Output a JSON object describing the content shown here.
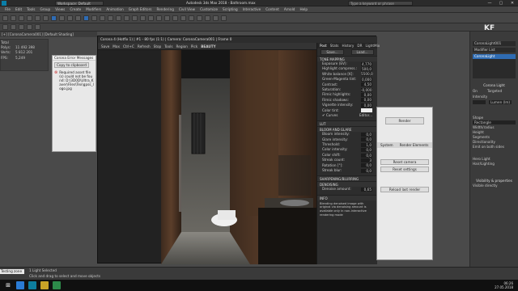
{
  "titlebar": {
    "workspace": "Workspace: Default",
    "title": "Autodesk 3ds Max 2018 - Bathroom.max",
    "search_placeholder": "Type a keyword or phrase",
    "min": "—",
    "max": "▢",
    "close": "✕"
  },
  "menu": [
    "File",
    "Edit",
    "Tools",
    "Group",
    "Views",
    "Create",
    "Modifiers",
    "Animation",
    "Graph Editors",
    "Rendering",
    "Civil View",
    "Customize",
    "Scripting",
    "Interactive",
    "Content",
    "Arnold",
    "Help"
  ],
  "viewport": {
    "label": "[+] [CoronaCamera001] [Default Shading]",
    "stats": {
      "total": "Total",
      "polys_label": "Polys:",
      "polys": "11 492 398",
      "verts_label": "Verts:",
      "verts": "5 812 201",
      "fps_label": "FPS:",
      "fps": "5,249"
    }
  },
  "error": {
    "title": "Corona Error Messages",
    "copy": "Copy to clipboard",
    "clear": "Clear",
    "msg": "Required asset file(s) could not be found: D:\\3D0D\\Ultra_Kaver\\Files\\Tex\\gpss_logo.jpg"
  },
  "vfb": {
    "title": "Corona 4 (Hotfix 1) | #1 - 80 fps (1:1) | Camera: CoronaCamera001 | Frame 0",
    "tools": [
      "Save",
      "Max",
      "Ctrl+C",
      "Refresh",
      "Stop",
      "Tools",
      "Region",
      "Pick",
      "BEAUTY"
    ],
    "tabs": [
      "Post",
      "Stats",
      "History",
      "DR",
      "LightMix"
    ],
    "save": "Save...",
    "load": "Load..."
  },
  "tone": {
    "header": "TONE MAPPING",
    "rows": [
      [
        "Exposure (EV):",
        "4,770"
      ],
      [
        "Highlight compress.:",
        "500,0"
      ],
      [
        "White balance [K]:",
        "5500,0"
      ],
      [
        "Green-Magenta tint:",
        "0,000"
      ],
      [
        "Contrast:",
        "4,50"
      ],
      [
        "Saturation:",
        "-0,000"
      ],
      [
        "Filmic highlights:",
        "0,00"
      ],
      [
        "Filmic shadows:",
        "0,00"
      ],
      [
        "Vignette intensity:",
        "0,00"
      ],
      [
        "Color tint:",
        ""
      ]
    ],
    "curves": "Curves",
    "editor": "Editor..."
  },
  "sections": {
    "lut": "LUT",
    "bloom": "BLOOM AND GLARE",
    "sharp": "SHARPENING/BLURRING",
    "denoise": "DENOISING",
    "info": "INFO"
  },
  "bloom": [
    [
      "Bloom intensity:",
      "0,0"
    ],
    [
      "Glare intensity:",
      "0,0"
    ],
    [
      "Threshold:",
      "1,0"
    ],
    [
      "Color intensity:",
      "0,0"
    ],
    [
      "Color shift:",
      "0,0"
    ],
    [
      "Streak count:",
      "3"
    ],
    [
      "Rotation [°]:",
      "0,0"
    ],
    [
      "Streak blur:",
      "0,0"
    ]
  ],
  "denoise_amount": [
    "Denoise amount:",
    "0,65"
  ],
  "info_text": "Blending denoised image with original via denoising amount is available only in non-interactive rendering mode",
  "renderset": {
    "render": "Render",
    "tabs": [
      "System",
      "Render Elements"
    ],
    "btn1": "Reset camera",
    "btn2": "Reset settings",
    "btn3": "Reload last render"
  },
  "cmd": {
    "name": "CoronaLight001",
    "modifier": "Modifier List",
    "stack": "CoronaLight",
    "roll": "Corona Light",
    "on": "On",
    "targeted": "Targeted",
    "intensity": "Intensity",
    "units": "Lumen (lm)",
    "shape": "Shape",
    "rect": "Rectangle",
    "width": "Width/radius",
    "height": "Height",
    "segments": "Segments",
    "directional": "Directionality",
    "hero": "Hero Light",
    "hair": "Hair/Lighting",
    "emit_both": "Emit on both sides",
    "visible": "Visible directly",
    "props": "Visibility & properties"
  },
  "status": {
    "sel": "1 Light Selected",
    "hint": "Click and drag to select and move objects",
    "script": "Testing zone"
  },
  "taskbar": {
    "time": "06:26",
    "date": "27.05.2018"
  },
  "logo": "KF school"
}
